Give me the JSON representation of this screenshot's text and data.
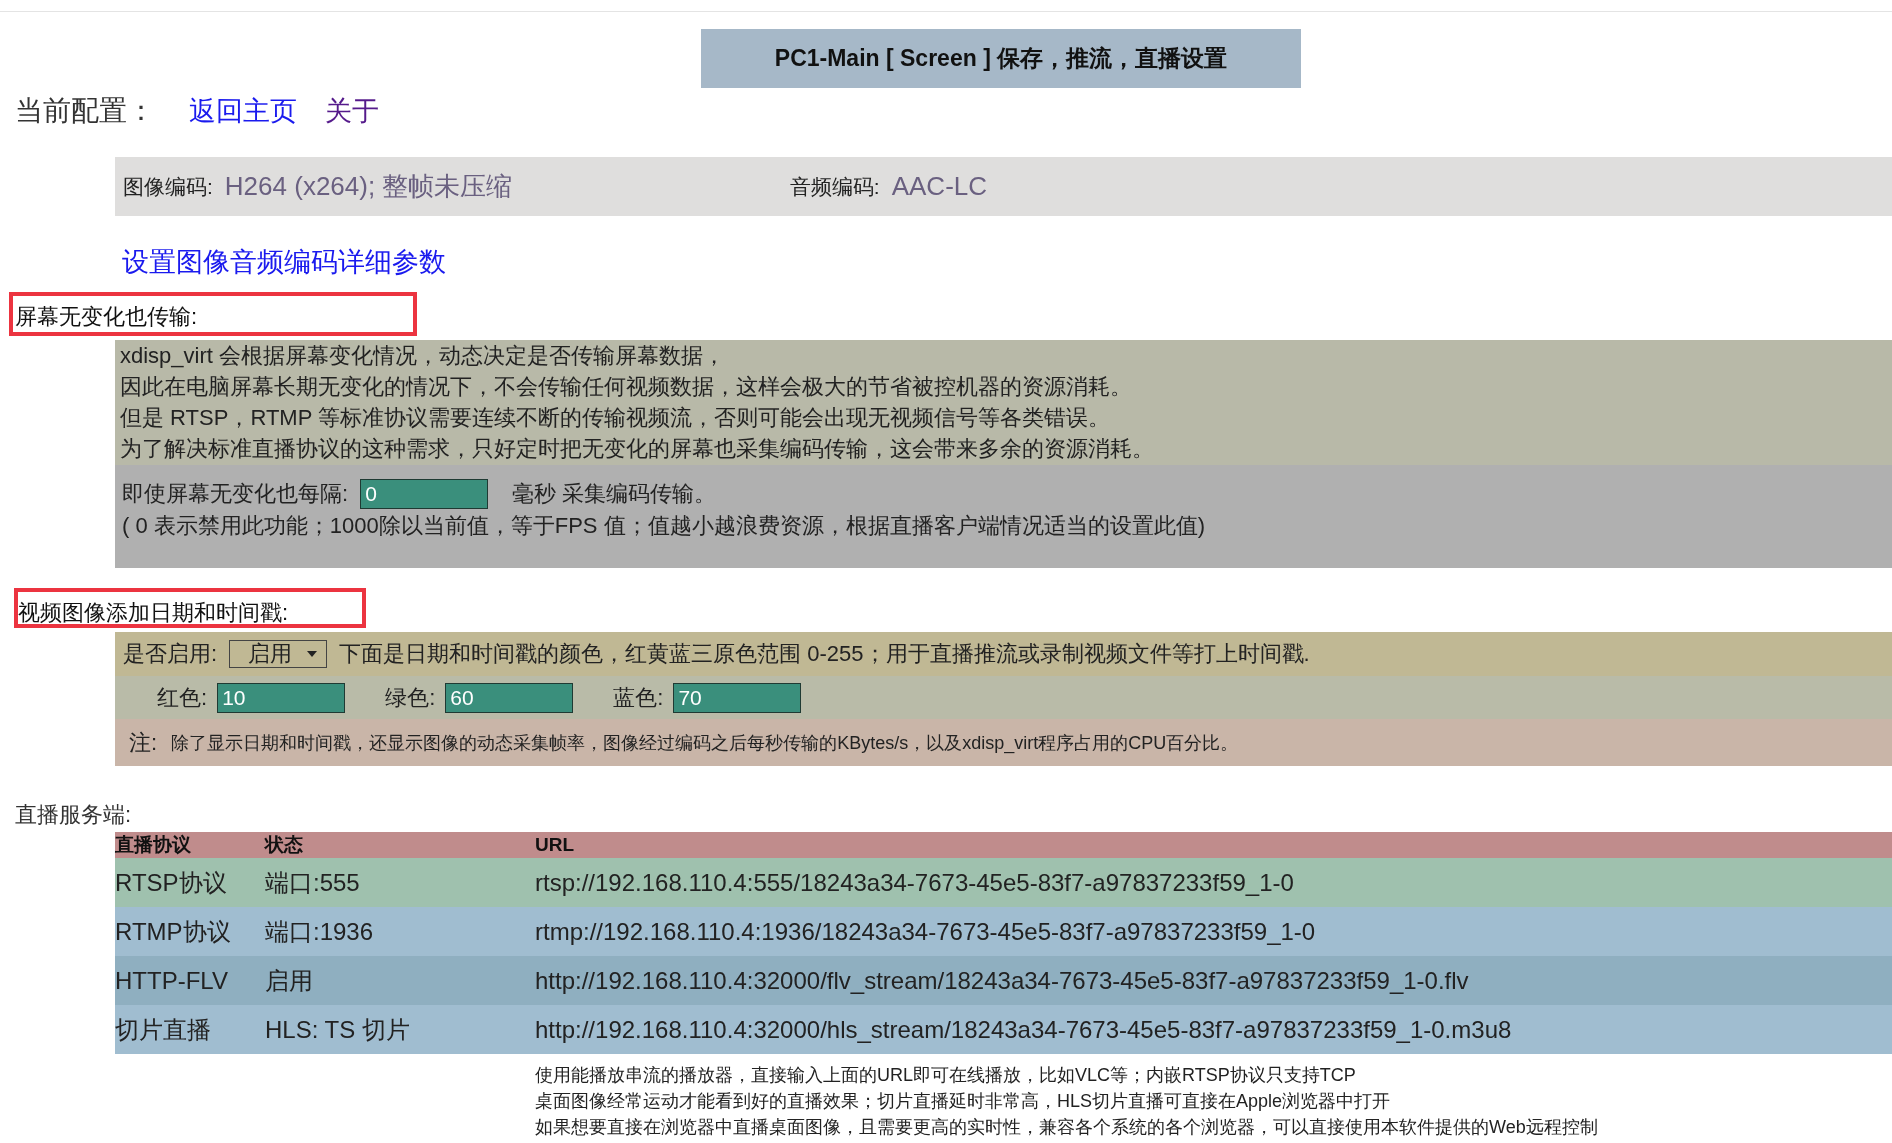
{
  "title": "PC1-Main [ Screen ] 保存，推流，直播设置",
  "nav": {
    "label": "当前配置：",
    "links": [
      {
        "text": "返回主页",
        "visited": false
      },
      {
        "text": "关于",
        "visited": true
      }
    ]
  },
  "codec": {
    "video_label": "图像编码:",
    "video_value": "H264 (x264); 整帧未压缩",
    "audio_label": "音频编码:",
    "audio_value": "AAC-LC"
  },
  "codec_link": "设置图像音频编码详细参数",
  "idle_section": {
    "heading": "屏幕无变化也传输:",
    "highlighted": true,
    "description": [
      "xdisp_virt 会根据屏幕变化情况，动态决定是否传输屏幕数据，",
      "因此在电脑屏幕长期无变化的情况下，不会传输任何视频数据，这样会极大的节省被控机器的资源消耗。",
      "但是 RTSP，RTMP 等标准协议需要连续不断的传输视频流，否则可能会出现无视频信号等各类错误。",
      "为了解决标准直播协议的这种需求，只好定时把无变化的屏幕也采集编码传输，这会带来多余的资源消耗。"
    ],
    "interval_label": "即使屏幕无变化也每隔:",
    "interval_value": "0",
    "interval_unit": "毫秒 采集编码传输。",
    "hint": "( 0 表示禁用此功能；1000除以当前值，等于FPS 值；值越小越浪费资源，根据直播客户端情况适当的设置此值)"
  },
  "timestamp_section": {
    "heading": "视频图像添加日期和时间戳:",
    "highlighted": true,
    "enable_label": "是否启用:",
    "enable_value": "启用",
    "description": "下面是日期和时间戳的颜色，红黄蓝三原色范围 0-255；用于直播推流或录制视频文件等打上时间戳.",
    "colors": [
      {
        "label": "红色:",
        "value": "10"
      },
      {
        "label": "绿色:",
        "value": "60"
      },
      {
        "label": "蓝色:",
        "value": "70"
      }
    ],
    "note_label": "注:",
    "note": "除了显示日期和时间戳，还显示图像的动态采集帧率，图像经过编码之后每秒传输的KBytes/s，以及xdisp_virt程序占用的CPU百分比。"
  },
  "server": {
    "heading": "直播服务端:",
    "columns": [
      "直播协议",
      "状态",
      "URL"
    ],
    "rows": [
      {
        "protocol": "RTSP协议",
        "status": "端口:555",
        "url": "rtsp://192.168.110.4:555/18243a34-7673-45e5-83f7-a97837233f59_1-0",
        "color": "#9fc1ae"
      },
      {
        "protocol": "RTMP协议",
        "status": "端口:1936",
        "url": "rtmp://192.168.110.4:1936/18243a34-7673-45e5-83f7-a97837233f59_1-0",
        "color": "#a0bdd0"
      },
      {
        "protocol": "HTTP-FLV",
        "status": "启用",
        "url": "http://192.168.110.4:32000/flv_stream/18243a34-7673-45e5-83f7-a97837233f59_1-0.flv",
        "color": "#8fafc0"
      },
      {
        "protocol": "切片直播",
        "status": "HLS:  TS 切片",
        "url": "http://192.168.110.4:32000/hls_stream/18243a34-7673-45e5-83f7-a97837233f59_1-0.m3u8",
        "color": "#a0bdd0"
      }
    ],
    "notes": [
      "使用能播放串流的播放器，直接输入上面的URL即可在线播放，比如VLC等；内嵌RTSP协议只支持TCP",
      "桌面图像经常运动才能看到好的直播效果；切片直播延时非常高，HLS切片直播可直接在Apple浏览器中打开",
      "如果想要直接在浏览器中直播桌面图像，且需要更高的实时性，兼容各个系统的各个浏览器，可以直接使用本软件提供的Web远程控制"
    ]
  }
}
